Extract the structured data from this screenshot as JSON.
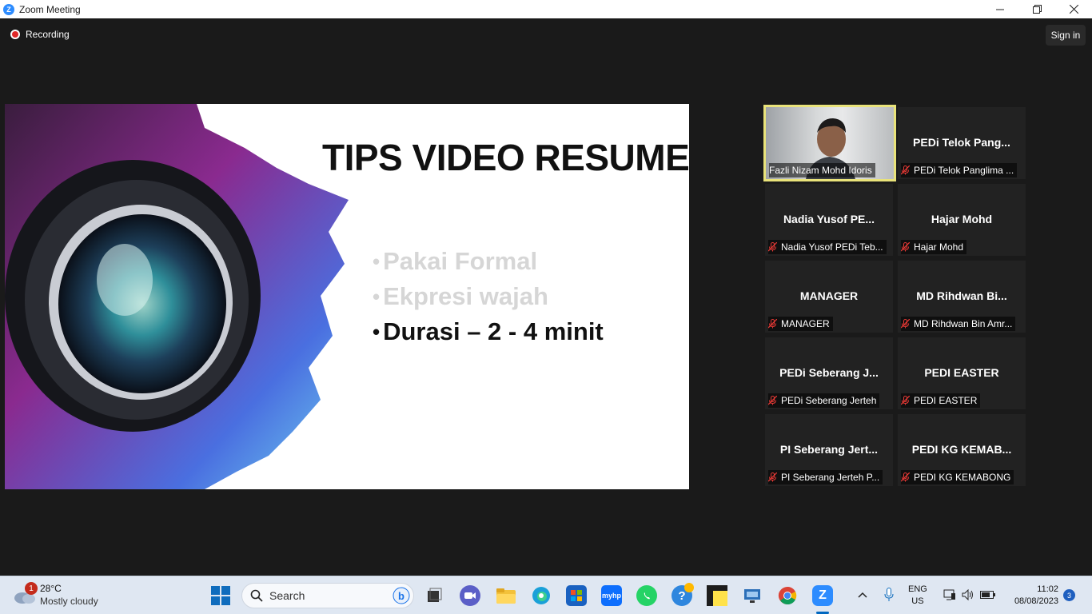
{
  "window": {
    "title": "Zoom Meeting",
    "app_icon": "Z",
    "controls": [
      "minimize-icon",
      "maximize-icon",
      "close-icon"
    ]
  },
  "meeting": {
    "recording_label": "Recording",
    "signin_label": "Sign in",
    "slide": {
      "title": "TIPS VIDEO RESUME",
      "bullets": [
        "Pakai Formal",
        "Ekpresi wajah",
        "Durasi – 2 - 4 minit"
      ]
    },
    "participants": [
      {
        "big_name": "",
        "label": "Fazli Nizam Mohd Idoris",
        "muted": false,
        "active_speaker": true
      },
      {
        "big_name": "PEDi Telok Pang...",
        "label": "PEDi Telok Panglima ...",
        "muted": true
      },
      {
        "big_name": "Nadia Yusof PE...",
        "label": "Nadia Yusof PEDi Teb...",
        "muted": true
      },
      {
        "big_name": "Hajar Mohd",
        "label": "Hajar Mohd",
        "muted": true
      },
      {
        "big_name": "MANAGER",
        "label": "MANAGER",
        "muted": true
      },
      {
        "big_name": "MD Rihdwan Bi...",
        "label": "MD Rihdwan Bin Amr...",
        "muted": true
      },
      {
        "big_name": "PEDi Seberang J...",
        "label": "PEDi Seberang Jerteh",
        "muted": true
      },
      {
        "big_name": "PEDI EASTER",
        "label": "PEDI EASTER",
        "muted": true
      },
      {
        "big_name": "PI Seberang Jert...",
        "label": "PI Seberang Jerteh P...",
        "muted": true
      },
      {
        "big_name": "PEDI KG KEMAB...",
        "label": "PEDI KG KEMABONG",
        "muted": true
      }
    ]
  },
  "taskbar": {
    "weather": {
      "badge": "1",
      "temp": "28°C",
      "condition": "Mostly cloudy"
    },
    "search_label": "Search",
    "apps": [
      "task-view",
      "teams-chat",
      "file-explorer",
      "edge",
      "microsoft-store",
      "myhp",
      "whatsapp",
      "get-help",
      "sticky-notes",
      "remote-desktop",
      "chrome",
      "zoom"
    ],
    "myhp_text": "myhp",
    "language": {
      "line1": "ENG",
      "line2": "US"
    },
    "clock": {
      "time": "11:02",
      "date": "08/08/2023"
    },
    "notification_count": "3",
    "colors": {
      "accent": "#0067c0",
      "active_speaker_border": "#e9e37a",
      "recording_red": "#e02828"
    }
  }
}
